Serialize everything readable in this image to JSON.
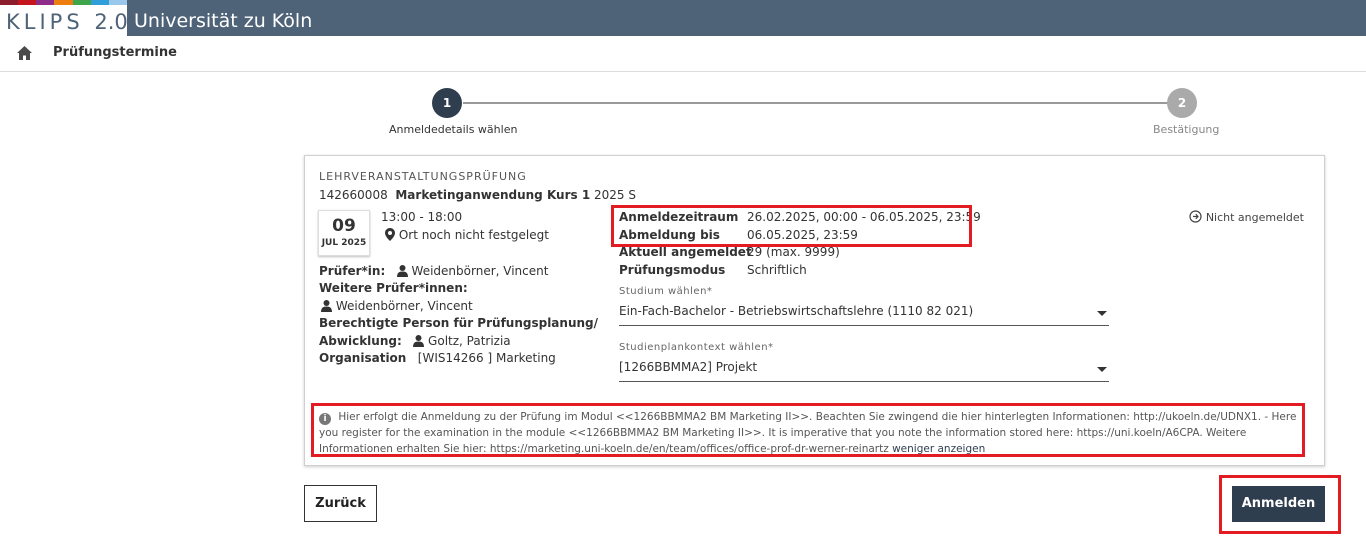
{
  "header": {
    "logo_text": "KLIPS",
    "logo_version": "2.0",
    "university": "Universität zu Köln",
    "stripe_colors": [
      "#8b1d2c",
      "#c5151d",
      "#8e2c8a",
      "#ee7d10",
      "#3ea54b",
      "#2e9fd9",
      "#9ac8ec"
    ],
    "bar_color": "#4e6378"
  },
  "nav": {
    "home_icon": "home-icon",
    "title": "Prüfungstermine"
  },
  "wizard": {
    "steps": [
      {
        "number": "1",
        "label": "Anmeldedetails wählen",
        "active": true
      },
      {
        "number": "2",
        "label": "Bestätigung",
        "active": false
      }
    ]
  },
  "course": {
    "type": "LEHRVERANSTALTUNGSPRÜFUNG",
    "number": "142660008",
    "title": "Marketinganwendung Kurs 1",
    "semester": "2025 S",
    "date_day": "09",
    "date_month": "JUL 2025",
    "time": "13:00 - 18:00",
    "location": "Ort noch nicht festgelegt",
    "examiner_label": "Prüfer*in:",
    "examiner": "Weidenbörner, Vincent",
    "other_examiners_label": "Weitere Prüfer*innen:",
    "other_examiner": "Weidenbörner, Vincent",
    "planner_label_1": "Berechtigte Person für Prüfungsplanung/",
    "planner_label_2": "Abwicklung:",
    "planner": "Goltz, Patrizia",
    "org_label": "Organisation",
    "org_value": "[WIS14266 ] Marketing"
  },
  "registration": {
    "period_label": "Anmeldezeitraum",
    "period_value": "26.02.2025, 00:00 - 06.05.2025, 23:59",
    "deregister_label": "Abmeldung bis",
    "deregister_value": "06.05.2025, 23:59",
    "current_label": "Aktuell angemeldet",
    "current_value": "29 (max. 9999)",
    "mode_label": "Prüfungsmodus",
    "mode_value": "Schriftlich",
    "status": "Nicht angemeldet"
  },
  "form": {
    "study_label": "Studium wählen*",
    "study_value": "Ein-Fach-Bachelor - Betriebswirtschaftslehre (1110 82 021)",
    "context_label": "Studienplankontext wählen*",
    "context_value": "[1266BBMMA2]  Projekt"
  },
  "info": {
    "text": "Hier erfolgt die Anmeldung zu der Prüfung im Modul <<1266BBMMA2 BM Marketing II>>. Beachten Sie zwingend die hier hinterlegten Informationen: http://ukoeln.de/UDNX1. - Here you register for the examination in the module <<1266BBMMA2 BM Marketing II>>. It is imperative that you note the information stored here: https://uni.koeln/A6CPA.  Weitere Informationen erhalten Sie hier: https://marketing.uni-koeln.de/en/team/offices/office-prof-dr-werner-reinartz",
    "less_link": "weniger anzeigen"
  },
  "buttons": {
    "back": "Zurück",
    "register": "Anmelden"
  },
  "highlight_color": "#e31b23"
}
